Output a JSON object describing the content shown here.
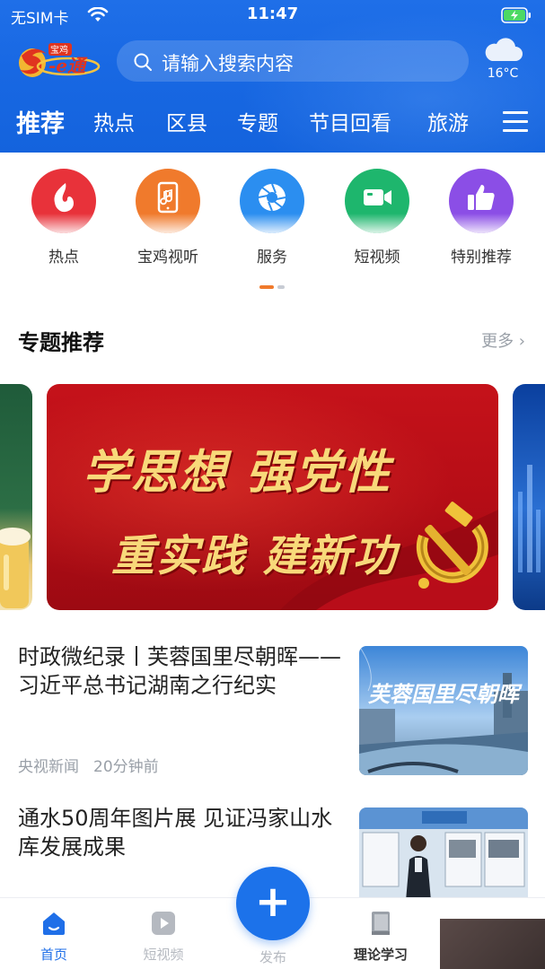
{
  "status": {
    "carrier": "无SIM卡",
    "time": "11:47"
  },
  "search": {
    "placeholder": "请输入搜索内容"
  },
  "weather": {
    "temp": "16°C",
    "icon": "cloud-icon"
  },
  "nav": {
    "tabs": [
      "推荐",
      "热点",
      "区县",
      "专题",
      "节目回看",
      "旅游"
    ],
    "active": "推荐"
  },
  "quick": {
    "items": [
      {
        "label": "热点",
        "icon": "flame-icon",
        "color": "#e8323a"
      },
      {
        "label": "宝鸡视听",
        "icon": "phone-music-icon",
        "color": "#f07a2c"
      },
      {
        "label": "服务",
        "icon": "aperture-icon",
        "color": "#2b8ef0"
      },
      {
        "label": "短视频",
        "icon": "video-camera-icon",
        "color": "#1eb66d"
      },
      {
        "label": "特别推荐",
        "icon": "thumbs-up-icon",
        "color": "#8b4ee6"
      }
    ]
  },
  "section": {
    "title": "专题推荐",
    "more": "更多 ›"
  },
  "banner": {
    "line1": "学思想 强党性",
    "line2": "重实践 建新功"
  },
  "news": [
    {
      "title": "时政微纪录丨芙蓉国里尽朝晖——习近平总书记湖南之行纪实",
      "source": "央视新闻",
      "time": "20分钟前",
      "thumb_caption": "芙蓉国里尽朝晖"
    },
    {
      "title": "通水50周年图片展 见证冯家山水库发展成果"
    }
  ],
  "tabbar": {
    "home": "首页",
    "video": "短视频",
    "publish": "发布",
    "study": "理论学习",
    "fab": "+"
  }
}
